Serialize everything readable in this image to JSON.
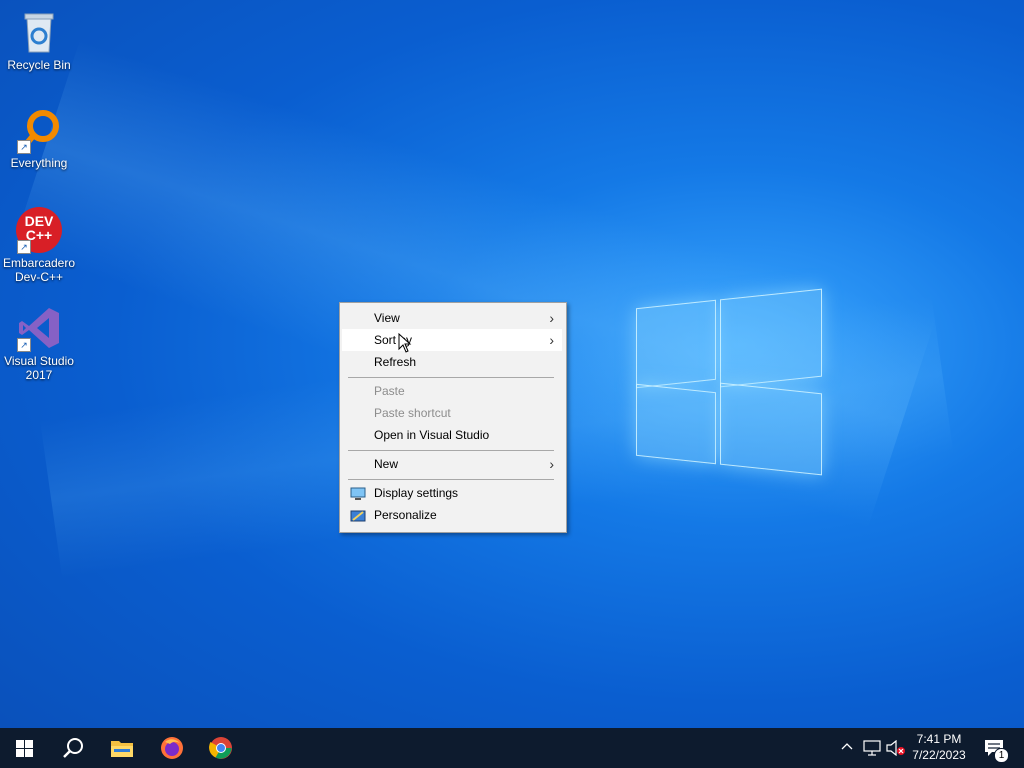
{
  "desktop": {
    "icons": [
      {
        "label": "Recycle Bin",
        "icon": "recycle-bin-icon"
      },
      {
        "label": "Everything",
        "icon": "everything-search-icon"
      },
      {
        "label": "Embarcadero Dev-C++",
        "icon": "devcpp-icon",
        "badge": "DEV C++"
      },
      {
        "label": "Visual Studio 2017",
        "icon": "visual-studio-icon"
      }
    ]
  },
  "context_menu": {
    "items": [
      {
        "label": "View",
        "submenu": true,
        "disabled": false
      },
      {
        "label": "Sort by",
        "submenu": true,
        "disabled": false,
        "hover": true
      },
      {
        "label": "Refresh",
        "submenu": false,
        "disabled": false
      },
      {
        "label": "Paste",
        "submenu": false,
        "disabled": true
      },
      {
        "label": "Paste shortcut",
        "submenu": false,
        "disabled": true
      },
      {
        "label": "Open in Visual Studio",
        "submenu": false,
        "disabled": false
      },
      {
        "label": "New",
        "submenu": true,
        "disabled": false
      },
      {
        "label": "Display settings",
        "submenu": false,
        "disabled": false,
        "icon": "display-icon"
      },
      {
        "label": "Personalize",
        "submenu": false,
        "disabled": false,
        "icon": "personalize-icon"
      }
    ],
    "submenu_arrow": "›"
  },
  "taskbar": {
    "apps": [
      "start-icon",
      "search-icon",
      "file-explorer-icon",
      "firefox-icon",
      "chrome-icon"
    ],
    "tray": {
      "time": "7:41 PM",
      "date": "7/22/2023",
      "notification_count": "1"
    }
  },
  "colors": {
    "desktop_bg": "#0a5ed0",
    "taskbar_bg": "#0d1b2e",
    "menu_bg": "#f2f2f2"
  }
}
